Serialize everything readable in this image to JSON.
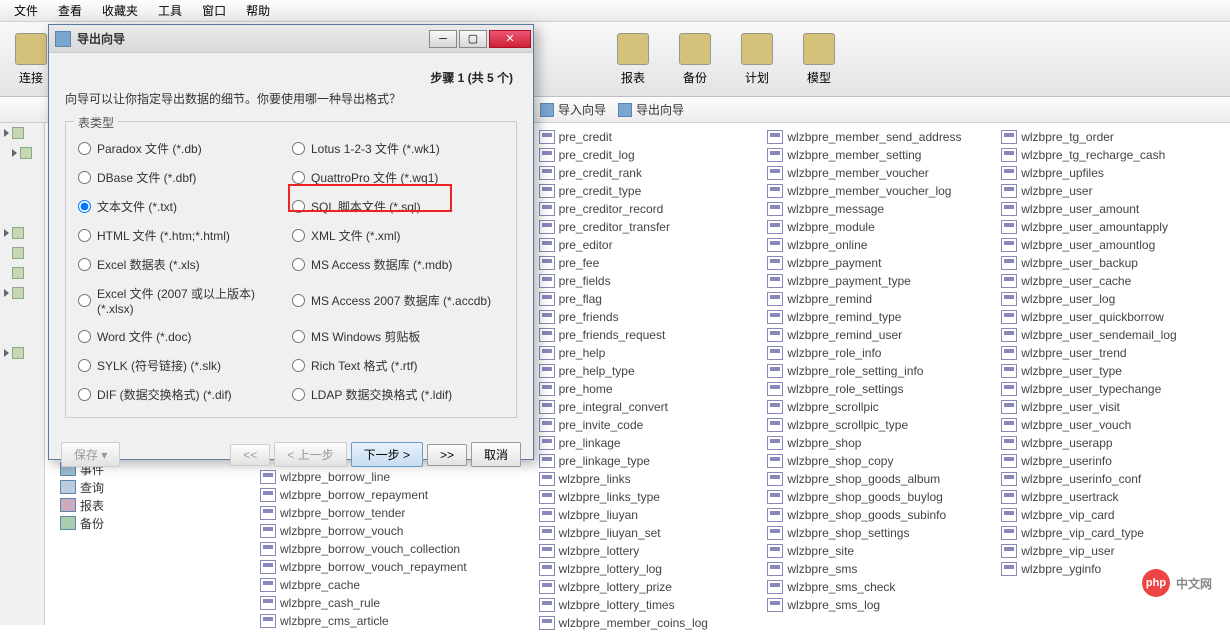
{
  "menu": [
    "文件",
    "查看",
    "收藏夹",
    "工具",
    "窗口",
    "帮助"
  ],
  "toolbar_far": [
    {
      "label": "连接"
    },
    {
      "label": "报表"
    },
    {
      "label": "备份"
    },
    {
      "label": "计划"
    },
    {
      "label": "模型"
    }
  ],
  "breadcrumb": [
    {
      "label": "导入向导"
    },
    {
      "label": "导出向导"
    }
  ],
  "tree_left": [
    {
      "label": "事件",
      "cls": "ev"
    },
    {
      "label": "查询",
      "cls": "qu"
    },
    {
      "label": "报表",
      "cls": "rp"
    },
    {
      "label": "备份",
      "cls": "bk"
    }
  ],
  "dialog": {
    "title": "导出向导",
    "step": "步骤 1 (共 5 个)",
    "instruction": "向导可以让你指定导出数据的细节。你要使用哪一种导出格式？",
    "group_title": "表类型",
    "options_left": [
      {
        "label": "Paradox 文件 (*.db)",
        "checked": false
      },
      {
        "label": "DBase 文件 (*.dbf)",
        "checked": false
      },
      {
        "label": "文本文件 (*.txt)",
        "checked": true
      },
      {
        "label": "HTML 文件 (*.htm;*.html)",
        "checked": false
      },
      {
        "label": "Excel 数据表 (*.xls)",
        "checked": false
      },
      {
        "label": "Excel 文件 (2007 或以上版本) (*.xlsx)",
        "checked": false
      },
      {
        "label": "Word 文件 (*.doc)",
        "checked": false
      },
      {
        "label": "SYLK (符号链接) (*.slk)",
        "checked": false
      },
      {
        "label": "DIF (数据交换格式) (*.dif)",
        "checked": false
      }
    ],
    "options_right": [
      {
        "label": "Lotus 1-2-3 文件 (*.wk1)",
        "checked": false
      },
      {
        "label": "QuattroPro 文件 (*.wq1)",
        "checked": false
      },
      {
        "label": "SQL 脚本文件 (*.sql)",
        "checked": false,
        "highlight": true
      },
      {
        "label": "XML 文件 (*.xml)",
        "checked": false
      },
      {
        "label": "MS Access 数据库 (*.mdb)",
        "checked": false
      },
      {
        "label": "MS Access 2007 数据库 (*.accdb)",
        "checked": false
      },
      {
        "label": "MS Windows 剪贴板",
        "checked": false
      },
      {
        "label": "Rich Text 格式 (*.rtf)",
        "checked": false
      },
      {
        "label": "LDAP 数据交换格式 (*.ldif)",
        "checked": false
      }
    ],
    "btn_save": "保存",
    "btn_back": "< 上一步",
    "btn_next": "下一步 >",
    "btn_jump": ">>",
    "btn_cancel": "取消"
  },
  "tables_col2": [
    "wlzbpre_borrow_line",
    "wlzbpre_borrow_repayment",
    "wlzbpre_borrow_tender",
    "wlzbpre_borrow_vouch",
    "wlzbpre_borrow_vouch_collection",
    "wlzbpre_borrow_vouch_repayment",
    "wlzbpre_cache",
    "wlzbpre_cash_rule",
    "wlzbpre_cms_article"
  ],
  "tables_col3": [
    "pre_credit",
    "pre_credit_log",
    "pre_credit_rank",
    "pre_credit_type",
    "pre_creditor_record",
    "pre_creditor_transfer",
    "pre_editor",
    "pre_fee",
    "pre_fields",
    "pre_flag",
    "pre_friends",
    "pre_friends_request",
    "pre_help",
    "pre_help_type",
    "pre_home",
    "pre_integral_convert",
    "pre_invite_code",
    "pre_linkage",
    "pre_linkage_type",
    "wlzbpre_links",
    "wlzbpre_links_type",
    "wlzbpre_liuyan",
    "wlzbpre_liuyan_set",
    "wlzbpre_lottery",
    "wlzbpre_lottery_log",
    "wlzbpre_lottery_prize",
    "wlzbpre_lottery_times",
    "wlzbpre_member_coins_log"
  ],
  "tables_col4": [
    "wlzbpre_member_send_address",
    "wlzbpre_member_setting",
    "wlzbpre_member_voucher",
    "wlzbpre_member_voucher_log",
    "wlzbpre_message",
    "wlzbpre_module",
    "wlzbpre_online",
    "wlzbpre_payment",
    "wlzbpre_payment_type",
    "wlzbpre_remind",
    "wlzbpre_remind_type",
    "wlzbpre_remind_user",
    "wlzbpre_role_info",
    "wlzbpre_role_setting_info",
    "wlzbpre_role_settings",
    "wlzbpre_scrollpic",
    "wlzbpre_scrollpic_type",
    "wlzbpre_shop",
    "wlzbpre_shop_copy",
    "wlzbpre_shop_goods_album",
    "wlzbpre_shop_goods_buylog",
    "wlzbpre_shop_goods_subinfo",
    "wlzbpre_shop_settings",
    "wlzbpre_site",
    "wlzbpre_sms",
    "wlzbpre_sms_check",
    "wlzbpre_sms_log"
  ],
  "tables_col5": [
    "wlzbpre_tg_order",
    "wlzbpre_tg_recharge_cash",
    "wlzbpre_upfiles",
    "wlzbpre_user",
    "wlzbpre_user_amount",
    "wlzbpre_user_amountapply",
    "wlzbpre_user_amountlog",
    "wlzbpre_user_backup",
    "wlzbpre_user_cache",
    "wlzbpre_user_log",
    "wlzbpre_user_quickborrow",
    "wlzbpre_user_sendemail_log",
    "wlzbpre_user_trend",
    "wlzbpre_user_type",
    "wlzbpre_user_typechange",
    "wlzbpre_user_visit",
    "wlzbpre_user_vouch",
    "wlzbpre_userapp",
    "wlzbpre_userinfo",
    "wlzbpre_userinfo_conf",
    "wlzbpre_usertrack",
    "wlzbpre_vip_card",
    "wlzbpre_vip_card_type",
    "wlzbpre_vip_user",
    "wlzbpre_yginfo"
  ],
  "sidebar_label_top": "连接",
  "watermark": "中文网"
}
